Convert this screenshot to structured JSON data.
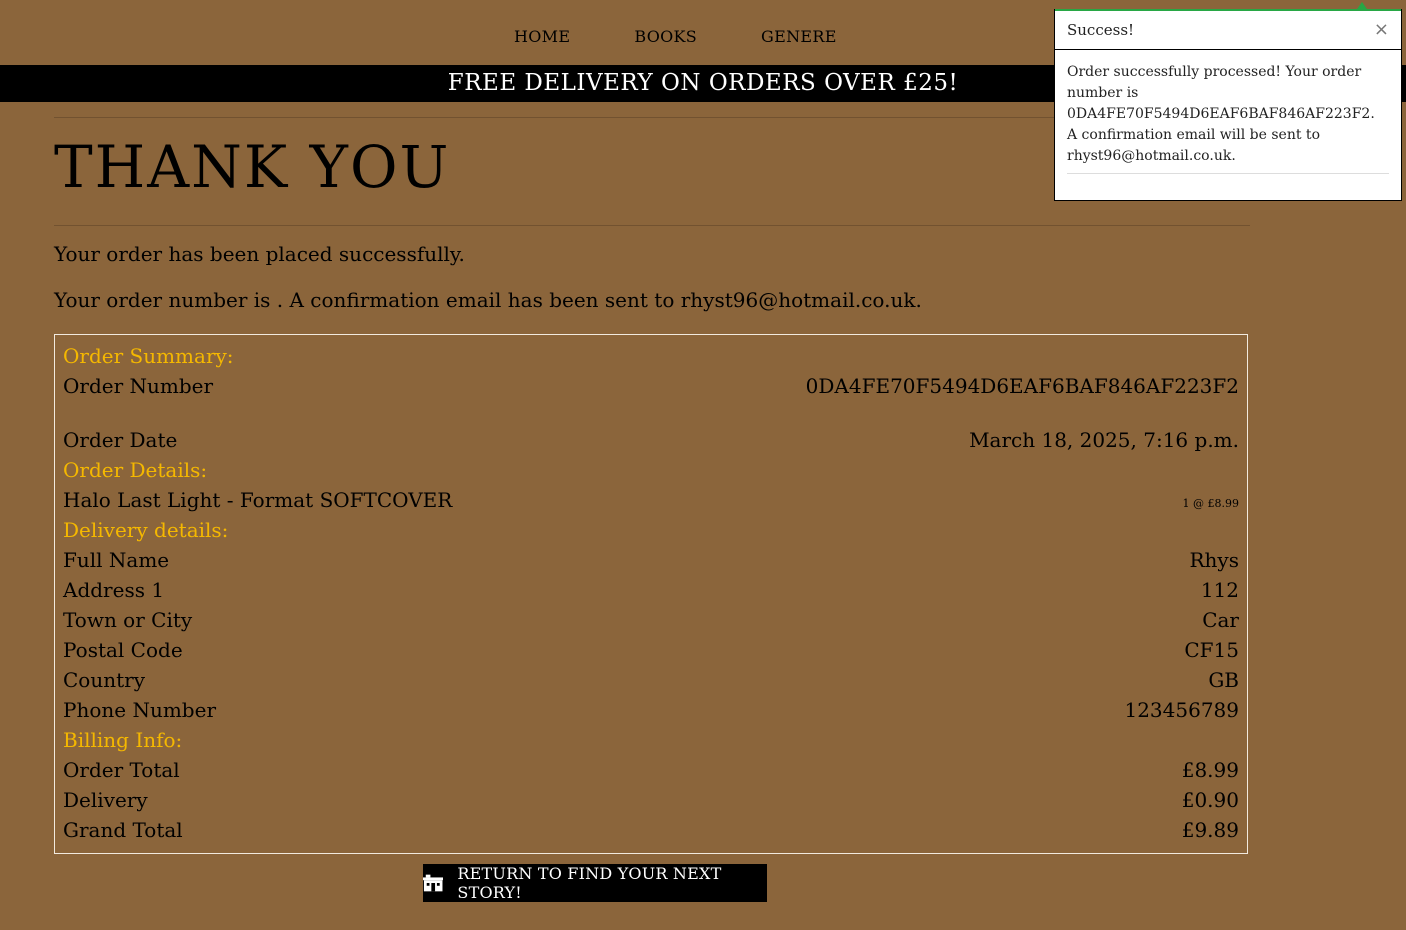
{
  "nav": {
    "items": [
      "HOME",
      "BOOKS",
      "GENERE"
    ]
  },
  "banner": {
    "text": "FREE DELIVERY ON ORDERS OVER £25!"
  },
  "page": {
    "title": "THANK YOU",
    "placed_message": "Your order has been placed successfully.",
    "number_message": "Your order number is . A confirmation email has been sent to rhyst96@hotmail.co.uk."
  },
  "summary": {
    "heading": "Order Summary:",
    "order_number_label": "Order Number",
    "order_number": "0DA4FE70F5494D6EAF6BAF846AF223F2",
    "order_date_label": "Order Date",
    "order_date": "March 18, 2025, 7:16 p.m.",
    "details_heading": "Order Details:",
    "item_label": "Halo Last Light - Format SOFTCOVER",
    "item_qty_price": "1 @ £8.99",
    "delivery_heading": "Delivery details:",
    "full_name_label": "Full Name",
    "full_name": "Rhys",
    "address1_label": "Address 1",
    "address1": "112",
    "town_label": "Town or City",
    "town": "Car",
    "postal_label": "Postal Code",
    "postal": "CF15",
    "country_label": "Country",
    "country": "GB",
    "phone_label": "Phone Number",
    "phone": "123456789",
    "billing_heading": "Billing Info:",
    "order_total_label": "Order Total",
    "order_total": "£8.99",
    "delivery_label": "Delivery",
    "delivery": "£0.90",
    "grand_total_label": "Grand Total",
    "grand_total": "£9.89"
  },
  "return_button": {
    "label": "RETURN TO FIND YOUR NEXT STORY!",
    "icon": "shop-icon"
  },
  "toast": {
    "title": "Success!",
    "close": "×",
    "message": "Order successfully processed! Your order number is 0DA4FE70F5494D6EAF6BAF846AF223F2. A confirmation email will be sent to rhyst96@hotmail.co.uk."
  },
  "colors": {
    "background": "#8b653b",
    "accent": "#f5b800",
    "banner": "#000000",
    "toast_accent": "#28a745"
  }
}
